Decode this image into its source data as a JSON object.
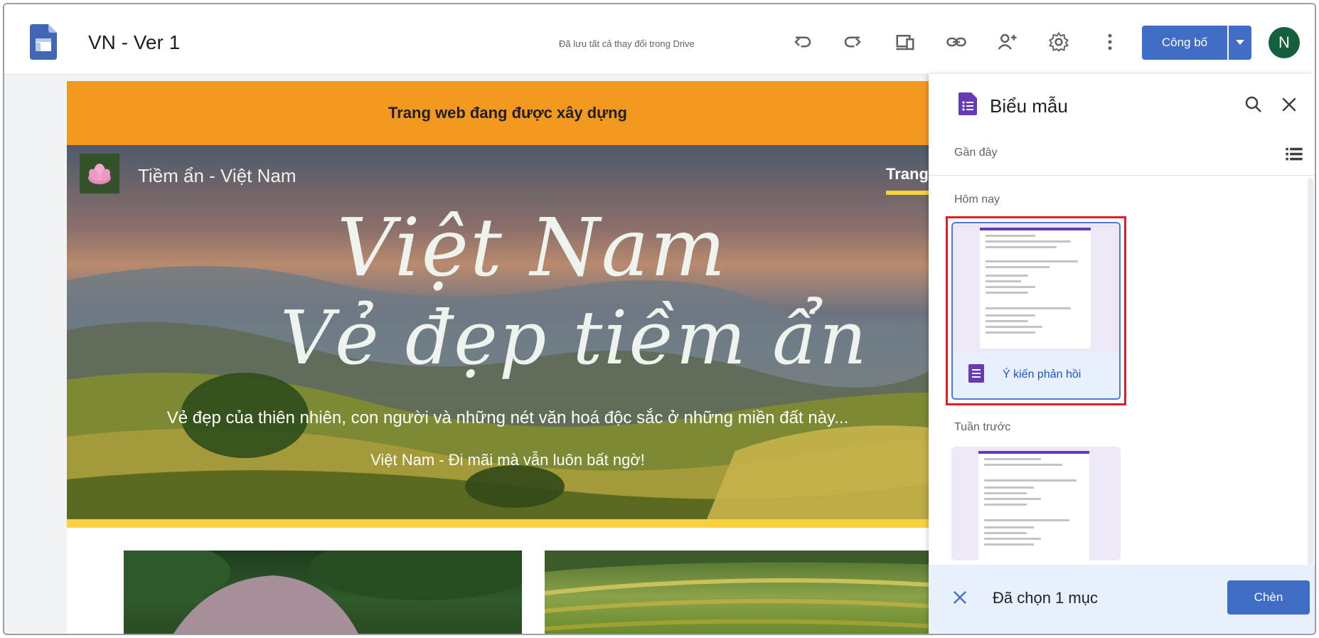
{
  "topbar": {
    "doc_title": "VN - Ver 1",
    "save_status": "Đã lưu tất cả thay đổi trong Drive",
    "publish_label": "Công bố",
    "avatar_initial": "N"
  },
  "site": {
    "banner": "Trang web đang được xây dựng",
    "site_name": "Tiềm ẩn - Việt Nam",
    "nav_home": "Trang",
    "hero_title_line1": "Việt Nam",
    "hero_title_line2": "Vẻ đẹp tiềm ẩn",
    "hero_subtitle": "Vẻ đẹp của thiên nhiên, con người và những nét văn hoá độc sắc ở những miền đất này...",
    "hero_tagline": "Việt Nam - Đi mãi mà vẫn luôn bất ngờ!"
  },
  "panel": {
    "title": "Biểu mẫu",
    "recent_label": "Gần đây",
    "today_label": "Hôm nay",
    "selected_form_label": "Ý kiến phản hồi",
    "last_week_label": "Tuần trước",
    "footer_text": "Đã chọn 1 mục",
    "insert_label": "Chèn"
  },
  "colors": {
    "accent_blue": "#3f6cc4",
    "banner_orange": "#f4991f",
    "selection_red": "#e21f26",
    "forms_purple": "#673ab7",
    "avatar_green": "#15603c",
    "hero_yellow": "#f7d23e"
  }
}
